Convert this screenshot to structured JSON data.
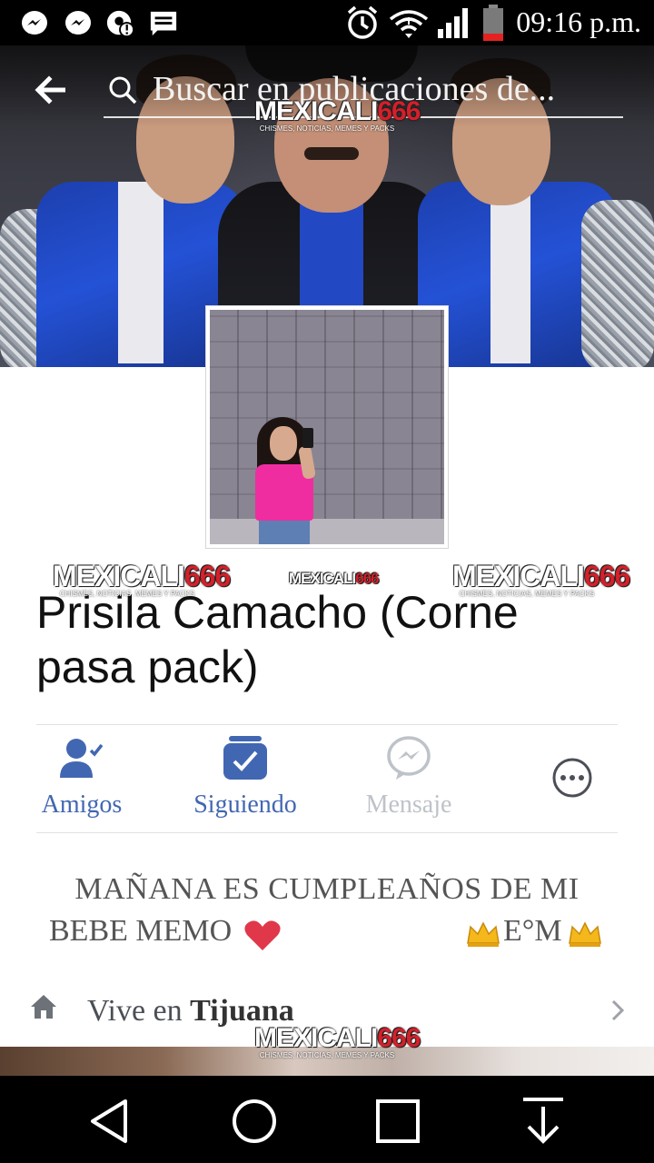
{
  "status_bar": {
    "time": "09:16 p.m.",
    "notifications": [
      "messenger-icon",
      "messenger-icon",
      "app-alert-icon",
      "message-icon"
    ],
    "system": [
      "alarm-icon",
      "wifi-icon",
      "signal-icon",
      "battery-icon"
    ]
  },
  "header": {
    "search_placeholder": "Buscar en publicaciones de..."
  },
  "watermarks": {
    "brand": "MEXICALI",
    "number": "666",
    "tagline": "CHISMES, NOTICIAS, MEMES Y PACKS"
  },
  "profile": {
    "name": "Prisila Camacho (Corne pasa pack)"
  },
  "actions": [
    {
      "label": "Amigos",
      "icon": "friends-check-icon",
      "color": "#4267b2"
    },
    {
      "label": "Siguiendo",
      "icon": "following-check-icon",
      "color": "#4267b2"
    },
    {
      "label": "Mensaje",
      "icon": "messenger-icon",
      "color": "#bec2c9"
    },
    {
      "label": "",
      "icon": "more-icon",
      "color": "#4b4f56"
    }
  ],
  "bio": {
    "line1": "MAÑANA ES CUMPLEAÑOS DE MI",
    "line2_left": "BEBE MEMO",
    "line2_right": "E°M"
  },
  "intro": {
    "lives_in_prefix": "Vive en",
    "lives_in_city": "Tijuana"
  },
  "colors": {
    "accent": "#4267b2",
    "muted": "#bec2c9",
    "watermark_red": "#d3202a"
  }
}
